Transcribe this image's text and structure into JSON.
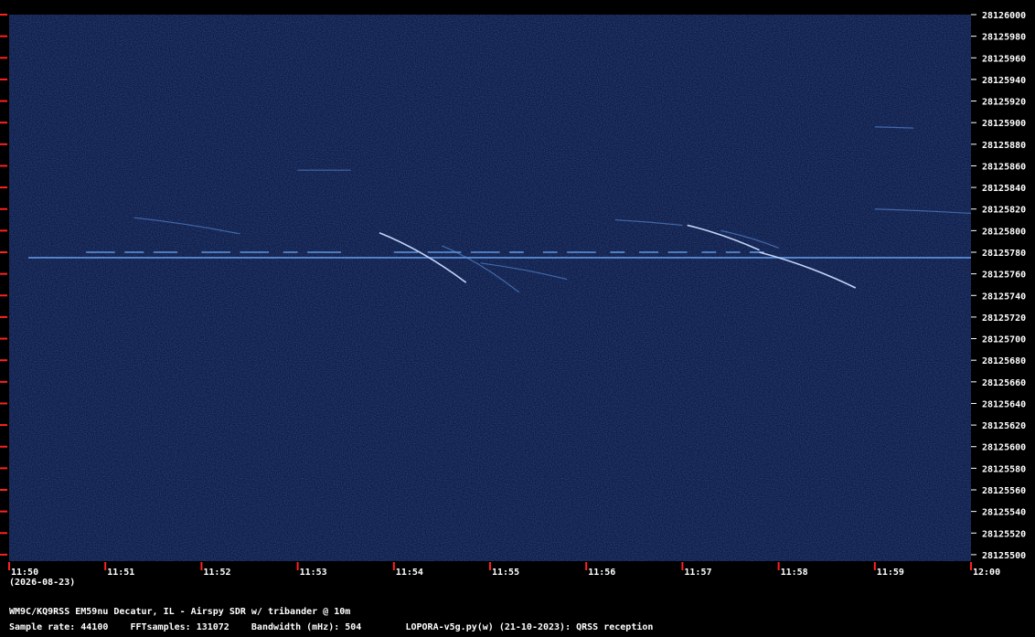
{
  "chart_data": {
    "type": "heatmap",
    "title": "",
    "xlabel": "",
    "ylabel": "",
    "x_tick_labels": [
      "11:50",
      "11:51",
      "11:52",
      "11:53",
      "11:54",
      "11:55",
      "11:56",
      "11:57",
      "11:58",
      "11:59",
      "12:00"
    ],
    "x_minutes": [
      0,
      1,
      2,
      3,
      4,
      5,
      6,
      7,
      8,
      9,
      10
    ],
    "xlim": [
      0,
      10
    ],
    "y_ticks": [
      28126000,
      28125980,
      28125960,
      28125940,
      28125920,
      28125900,
      28125880,
      28125860,
      28125840,
      28125820,
      28125800,
      28125780,
      28125760,
      28125740,
      28125720,
      28125700,
      28125680,
      28125660,
      28125640,
      28125620,
      28125600,
      28125580,
      28125560,
      28125540,
      28125520,
      28125500
    ],
    "ylim": [
      28125494,
      28126000
    ],
    "grid": false,
    "colors": {
      "background": "#0d1b45",
      "signal": "#5f95e0",
      "bright": "#ffffff",
      "tick": "#ff2020"
    },
    "carrier": {
      "freq": 28125775,
      "start_min": 0.2,
      "end_min": 10
    },
    "qrss_keying": [
      {
        "t0": 0.8,
        "t1": 1.1,
        "level": 28125780
      },
      {
        "t0": 1.2,
        "t1": 1.4,
        "level": 28125780
      },
      {
        "t0": 1.5,
        "t1": 1.75,
        "level": 28125780
      },
      {
        "t0": 2.0,
        "t1": 2.3,
        "level": 28125780
      },
      {
        "t0": 2.4,
        "t1": 2.7,
        "level": 28125780
      },
      {
        "t0": 2.85,
        "t1": 3.0,
        "level": 28125780
      },
      {
        "t0": 3.1,
        "t1": 3.45,
        "level": 28125780
      },
      {
        "t0": 4.0,
        "t1": 4.25,
        "level": 28125780
      },
      {
        "t0": 4.35,
        "t1": 4.7,
        "level": 28125780
      },
      {
        "t0": 4.8,
        "t1": 5.1,
        "level": 28125780
      },
      {
        "t0": 5.2,
        "t1": 5.35,
        "level": 28125780
      },
      {
        "t0": 5.55,
        "t1": 5.7,
        "level": 28125780
      },
      {
        "t0": 5.8,
        "t1": 6.1,
        "level": 28125780
      },
      {
        "t0": 6.25,
        "t1": 6.4,
        "level": 28125780
      },
      {
        "t0": 6.55,
        "t1": 6.75,
        "level": 28125780
      },
      {
        "t0": 6.85,
        "t1": 7.05,
        "level": 28125780
      },
      {
        "t0": 7.2,
        "t1": 7.35,
        "level": 28125780
      },
      {
        "t0": 7.45,
        "t1": 7.6,
        "level": 28125780
      },
      {
        "t0": 7.7,
        "t1": 7.85,
        "level": 28125780
      }
    ],
    "drifting_traces": [
      {
        "t0": 3.85,
        "f0": 28125798,
        "t1": 4.75,
        "f1": 28125752,
        "bright": true
      },
      {
        "t0": 4.5,
        "f0": 28125786,
        "t1": 5.3,
        "f1": 28125743,
        "bright": false
      },
      {
        "t0": 4.9,
        "f0": 28125770,
        "t1": 5.8,
        "f1": 28125755,
        "bright": false
      },
      {
        "t0": 1.3,
        "f0": 28125812,
        "t1": 2.4,
        "f1": 28125797,
        "bright": false
      },
      {
        "t0": 6.3,
        "f0": 28125810,
        "t1": 7.0,
        "f1": 28125805,
        "bright": false
      },
      {
        "t0": 7.05,
        "f0": 28125805,
        "t1": 7.8,
        "f1": 28125782,
        "bright": true
      },
      {
        "t0": 7.8,
        "f0": 28125780,
        "t1": 8.8,
        "f1": 28125747,
        "bright": true
      },
      {
        "t0": 7.4,
        "f0": 28125800,
        "t1": 8.0,
        "f1": 28125784,
        "bright": false
      },
      {
        "t0": 9.0,
        "f0": 28125820,
        "t1": 10.0,
        "f1": 28125816,
        "bright": false
      },
      {
        "t0": 9.0,
        "f0": 28125896,
        "t1": 9.4,
        "f1": 28125895,
        "bright": false
      },
      {
        "t0": 3.0,
        "f0": 28125856,
        "t1": 3.55,
        "f1": 28125856,
        "bright": false
      }
    ]
  },
  "footer": {
    "date": "(2026-08-23)",
    "station": "WM9C/KQ9RSS EM59nu Decatur, IL - Airspy SDR w/ tribander @ 10m",
    "line2": "Sample rate: 44100    FFTsamples: 131072    Bandwidth (mHz): 504        LOPORA-v5g.py(w) (21-10-2023): QRSS reception"
  }
}
